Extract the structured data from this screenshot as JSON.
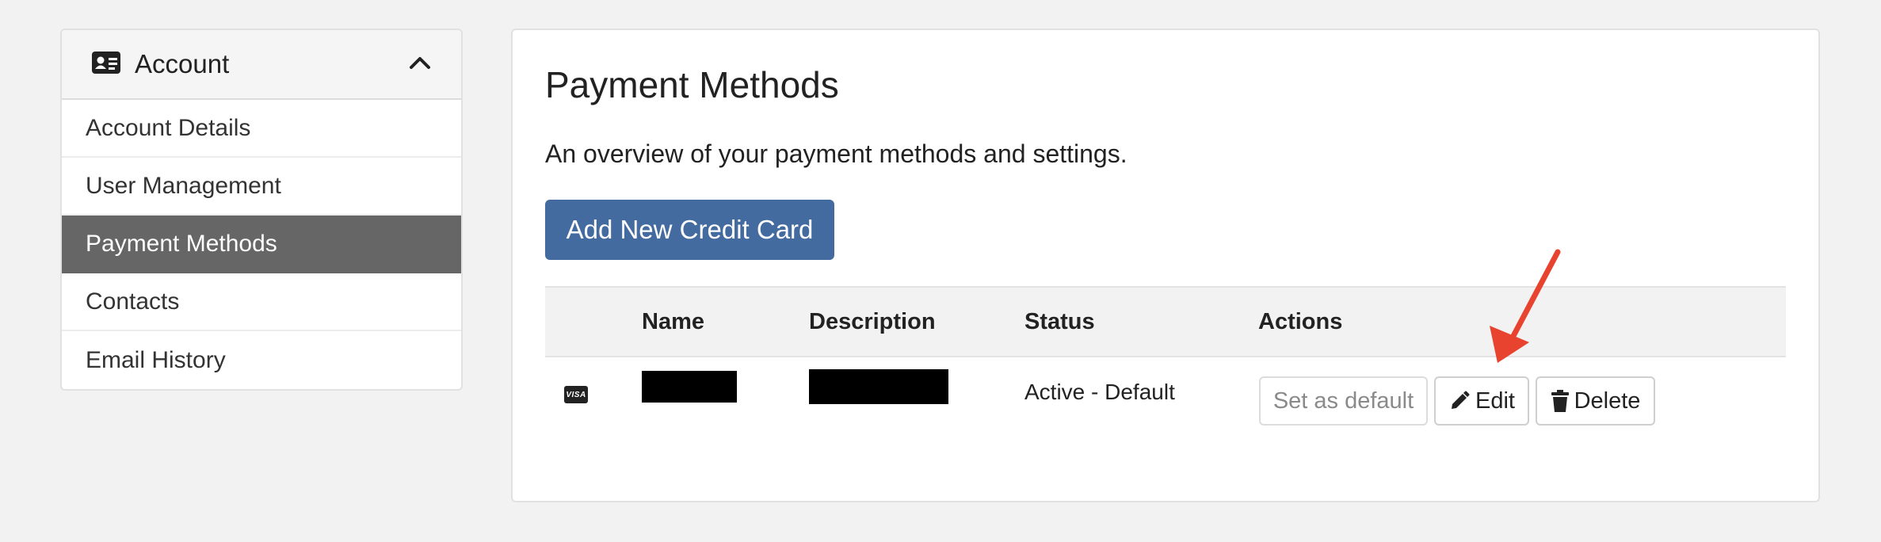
{
  "sidebar": {
    "header": {
      "title": "Account",
      "icon": "id-card-icon",
      "toggle_icon": "chevron-up-icon"
    },
    "items": [
      {
        "label": "Account Details",
        "active": false
      },
      {
        "label": "User Management",
        "active": false
      },
      {
        "label": "Payment Methods",
        "active": true
      },
      {
        "label": "Contacts",
        "active": false
      },
      {
        "label": "Email History",
        "active": false
      }
    ],
    "active_color": "#666666"
  },
  "main": {
    "title": "Payment Methods",
    "subtitle": "An overview of your payment methods and settings.",
    "add_button_label": "Add New Credit Card",
    "accent": "#436ba0",
    "table": {
      "headers": [
        "",
        "Name",
        "Description",
        "Status",
        "Actions"
      ],
      "rows": [
        {
          "card_icon": "visa-icon",
          "card_brand": "VISA",
          "name": "[redacted]",
          "description": "[redacted]",
          "status": "Active - Default",
          "actions": {
            "set_default": "Set as default",
            "edit": "Edit",
            "delete": "Delete"
          }
        }
      ]
    }
  },
  "annotation": {
    "arrow_color": "#e8432e",
    "target": "Edit"
  }
}
